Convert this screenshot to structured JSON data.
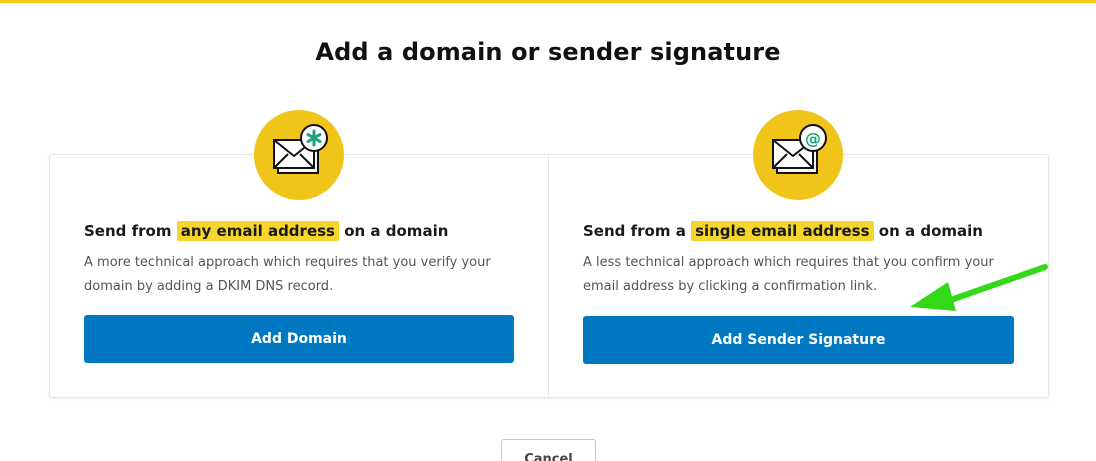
{
  "page": {
    "title": "Add a domain or sender signature"
  },
  "options": [
    {
      "heading_prefix": "Send from",
      "heading_highlight": "any email address",
      "heading_suffix": "on a domain",
      "description_line1": "A more technical approach which requires that you verify your",
      "description_line2": "domain by adding a DKIM DNS record.",
      "button_label": "Add Domain",
      "icon": "envelope-asterisk-icon"
    },
    {
      "heading_prefix": "Send from a",
      "heading_highlight": "single email address",
      "heading_suffix": "on a domain",
      "description_line1": "A less technical approach which requires that you confirm your",
      "description_line2": "email address by clicking a confirmation link.",
      "button_label": "Add Sender Signature",
      "icon": "envelope-at-icon"
    }
  ],
  "footer": {
    "cancel_label": "Cancel"
  },
  "colors": {
    "accent_yellow": "#f0c419",
    "highlight_yellow": "#f6d52c",
    "primary_blue": "#0079c2",
    "annotation_green": "#33d916",
    "icon_badge_green": "#1aa37a"
  },
  "annotation": {
    "icon": "green-arrow-icon"
  }
}
